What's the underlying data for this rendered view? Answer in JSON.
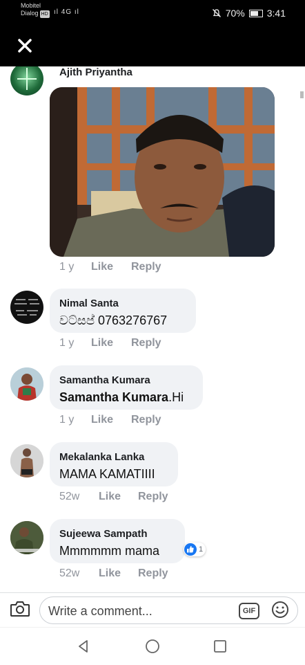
{
  "status_bar": {
    "carrier_line1": "Mobitel",
    "carrier_line2": "Dialog",
    "hd_badge": "HD",
    "signal_text": "ıl 4G ıl",
    "mute_icon": "bell-off-icon",
    "battery_percent": "70%",
    "battery_level": 0.7,
    "time": "3:41"
  },
  "header": {
    "close_icon": "close-icon"
  },
  "comments": [
    {
      "name": "Ajith Priyantha",
      "text": "",
      "has_photo": true,
      "time": "1 y",
      "like_label": "Like",
      "reply_label": "Reply"
    },
    {
      "name": "Nimal Santa",
      "text": "වට්සප් 0763276767",
      "time": "1 y",
      "like_label": "Like",
      "reply_label": "Reply"
    },
    {
      "name": "Samantha Kumara",
      "text_bold": "Samantha Kumara",
      "text_rest": ".Hi",
      "time": "1 y",
      "like_label": "Like",
      "reply_label": "Reply"
    },
    {
      "name": "Mekalanka Lanka",
      "text": "MAMA KAMATIIII",
      "time": "52w",
      "like_label": "Like",
      "reply_label": "Reply"
    },
    {
      "name": "Sujeewa Sampath",
      "text": "Mmmmmm mama",
      "time": "52w",
      "like_label": "Like",
      "reply_label": "Reply",
      "reaction": {
        "icon": "thumbs-up-icon",
        "count": "1"
      }
    }
  ],
  "composer": {
    "placeholder": "Write a comment...",
    "camera_icon": "camera-icon",
    "gif_label": "GIF",
    "emoji_icon": "smiley-icon"
  },
  "nav": {
    "back_icon": "triangle-back-icon",
    "home_icon": "circle-home-icon",
    "recents_icon": "square-recents-icon"
  },
  "colors": {
    "header_bg": "#000000",
    "bubble_bg": "#f0f2f5",
    "meta_gray": "#90949c",
    "like_blue": "#1877f2"
  }
}
